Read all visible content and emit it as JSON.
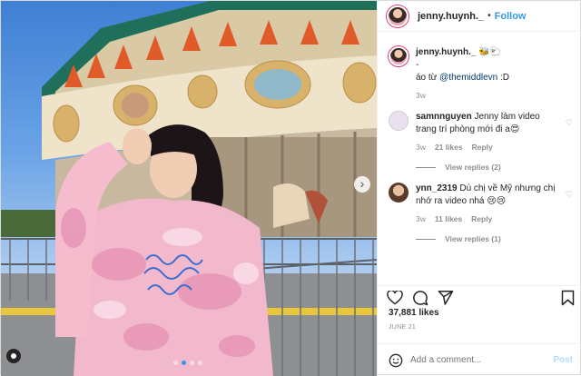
{
  "header": {
    "username": "jenny.huynh._",
    "separator": "•",
    "follow_label": "Follow"
  },
  "caption": {
    "username": "jenny.huynh._",
    "emoji_after_name": "🐝🐑",
    "dash": "-",
    "text_prefix": "áo từ ",
    "mention": "@themiddlevn",
    "text_suffix": " :D",
    "age": "3w"
  },
  "comments": [
    {
      "username": "samnnguyen",
      "text": "Jenny làm video trang trí phòng mới đi a😍",
      "age": "3w",
      "likes": "21 likes",
      "reply": "Reply",
      "view_replies": "View replies (2)"
    },
    {
      "username": "ynn_2319",
      "text": "Dù chị về Mỹ nhưng chị nhớ ra video nhá 😢😢",
      "age": "3w",
      "likes": "11 likes",
      "reply": "Reply",
      "view_replies": "View replies (1)"
    }
  ],
  "likes": "37,881 likes",
  "date": "JUNE 21",
  "comment_box": {
    "placeholder": "Add a comment...",
    "post_label": "Post"
  },
  "photo": {
    "carousel_dots": 4,
    "active_dot": 1
  },
  "colors": {
    "accent": "#3897f0",
    "text": "#262626",
    "muted": "#8e8e8e",
    "sky": "#4a86d8"
  },
  "icons": [
    "heart-icon",
    "comment-icon",
    "share-icon",
    "bookmark-icon",
    "smiley-icon",
    "tag-icon",
    "chevron-right-icon"
  ]
}
